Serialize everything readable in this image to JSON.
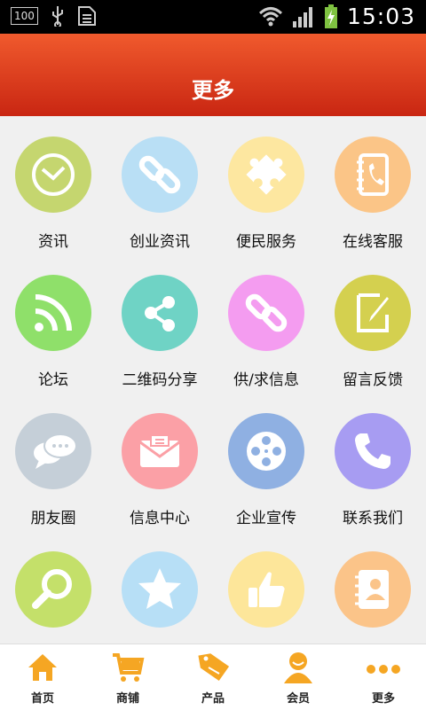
{
  "status_bar": {
    "battery_level": "100",
    "time": "15:03"
  },
  "header": {
    "title": "更多"
  },
  "grid": {
    "items": [
      {
        "label": "资讯",
        "icon": "clock-icon",
        "color": "#c5d66f"
      },
      {
        "label": "创业资讯",
        "icon": "link-icon",
        "color": "#b9dff5"
      },
      {
        "label": "便民服务",
        "icon": "puzzle-icon",
        "color": "#fde7a0"
      },
      {
        "label": "在线客服",
        "icon": "phone-book-icon",
        "color": "#fbc587"
      },
      {
        "label": "论坛",
        "icon": "rss-icon",
        "color": "#8fe06a"
      },
      {
        "label": "二维码分享",
        "icon": "share-icon",
        "color": "#6fd3c5"
      },
      {
        "label": "供/求信息",
        "icon": "link-icon",
        "color": "#f49cf0"
      },
      {
        "label": "留言反馈",
        "icon": "edit-icon",
        "color": "#d4d04f"
      },
      {
        "label": "朋友圈",
        "icon": "chat-bubbles-icon",
        "color": "#c5cfd8"
      },
      {
        "label": "信息中心",
        "icon": "mail-icon",
        "color": "#fba0a6"
      },
      {
        "label": "企业宣传",
        "icon": "film-reel-icon",
        "color": "#8fb0e2"
      },
      {
        "label": "联系我们",
        "icon": "phone-icon",
        "color": "#a79cf2"
      },
      {
        "label": "",
        "icon": "search-icon",
        "color": "#c4e06a"
      },
      {
        "label": "",
        "icon": "star-icon",
        "color": "#b7dff6"
      },
      {
        "label": "",
        "icon": "thumbs-up-icon",
        "color": "#fde69a"
      },
      {
        "label": "",
        "icon": "contacts-icon",
        "color": "#fbc489"
      }
    ]
  },
  "tabbar": {
    "accent": "#f5a623",
    "tabs": [
      {
        "label": "首页",
        "icon": "home-icon"
      },
      {
        "label": "商铺",
        "icon": "cart-icon"
      },
      {
        "label": "产品",
        "icon": "sale-tag-icon"
      },
      {
        "label": "会员",
        "icon": "user-icon"
      },
      {
        "label": "更多",
        "icon": "more-dots-icon"
      }
    ]
  }
}
